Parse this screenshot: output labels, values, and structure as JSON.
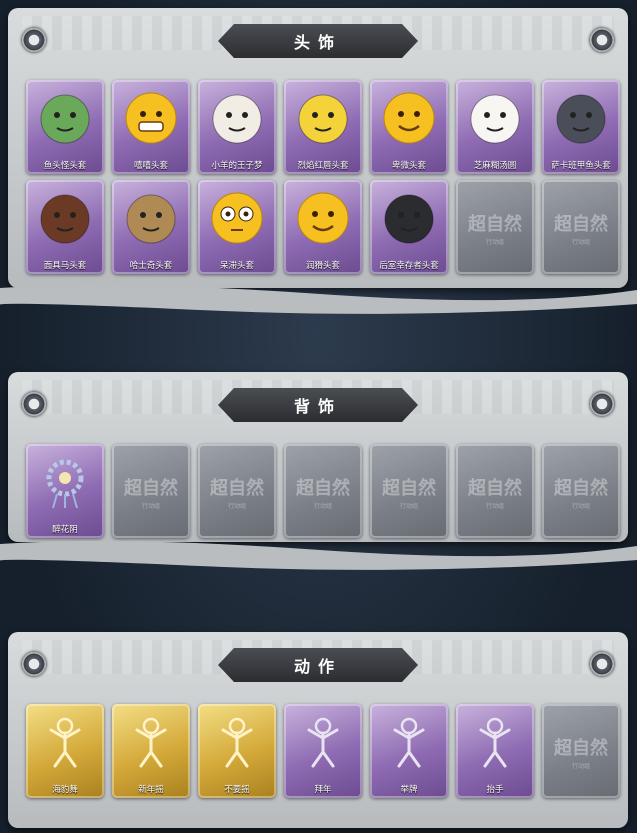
{
  "sections": [
    {
      "title": "头饰",
      "items": [
        {
          "label": "鱼头怪头套",
          "variant": "purple",
          "icon": "fish-mask-icon",
          "color": "#6aa85a"
        },
        {
          "label": "嘻嘻头套",
          "variant": "purple",
          "icon": "grin-emoji-icon",
          "color": "#f5c020"
        },
        {
          "label": "小羊的王子梦",
          "variant": "purple",
          "icon": "sheep-crown-icon",
          "color": "#f1ece4"
        },
        {
          "label": "烈焰红唇头套",
          "variant": "purple",
          "icon": "yellow-mouse-icon",
          "color": "#f3d23a"
        },
        {
          "label": "卑微头套",
          "variant": "purple",
          "icon": "timid-emoji-icon",
          "color": "#f5c020"
        },
        {
          "label": "芝麻糊汤圆",
          "variant": "purple",
          "icon": "dumpling-icon",
          "color": "#f8f6f2"
        },
        {
          "label": "萨卡班甲鱼头套",
          "variant": "purple",
          "icon": "fish-head-icon",
          "color": "#4a4e58"
        },
        {
          "label": "面具马头套",
          "variant": "purple",
          "icon": "horse-mask-icon",
          "color": "#6b3a24"
        },
        {
          "label": "哈士奇头套",
          "variant": "purple",
          "icon": "husky-icon",
          "color": "#b08a55"
        },
        {
          "label": "呆滞头套",
          "variant": "purple",
          "icon": "stunned-emoji-icon",
          "color": "#f5c020"
        },
        {
          "label": "润猾头套",
          "variant": "purple",
          "icon": "smirk-emoji-icon",
          "color": "#f5c020"
        },
        {
          "label": "后室幸存者头套",
          "variant": "purple",
          "icon": "gas-mask-icon",
          "color": "#2a2c30"
        },
        {
          "label": "",
          "variant": "empty",
          "icon": "locked-placeholder-icon"
        },
        {
          "label": "",
          "variant": "empty",
          "icon": "locked-placeholder-icon"
        }
      ]
    },
    {
      "title": "背饰",
      "items": [
        {
          "label": "醉花阴",
          "variant": "purple",
          "icon": "flower-wreath-icon",
          "color": "#b7c9e8"
        },
        {
          "label": "",
          "variant": "empty",
          "icon": "locked-placeholder-icon"
        },
        {
          "label": "",
          "variant": "empty",
          "icon": "locked-placeholder-icon"
        },
        {
          "label": "",
          "variant": "empty",
          "icon": "locked-placeholder-icon"
        },
        {
          "label": "",
          "variant": "empty",
          "icon": "locked-placeholder-icon"
        },
        {
          "label": "",
          "variant": "empty",
          "icon": "locked-placeholder-icon"
        },
        {
          "label": "",
          "variant": "empty",
          "icon": "locked-placeholder-icon"
        }
      ]
    },
    {
      "title": "动作",
      "items": [
        {
          "label": "海豹舞",
          "variant": "gold",
          "icon": "pose-figure-icon",
          "color": "#fff3c8"
        },
        {
          "label": "新年摇",
          "variant": "gold",
          "icon": "pose-figure-icon",
          "color": "#fff3c8"
        },
        {
          "label": "不要摇",
          "variant": "gold",
          "icon": "pose-figure-icon",
          "color": "#fff3c8"
        },
        {
          "label": "拜年",
          "variant": "purple",
          "icon": "bow-figure-icon",
          "color": "#e9e4f2"
        },
        {
          "label": "举牌",
          "variant": "purple",
          "icon": "sign-figure-icon",
          "color": "#e9e4f2"
        },
        {
          "label": "抬手",
          "variant": "purple",
          "icon": "raise-hand-icon",
          "color": "#e9e4f2"
        },
        {
          "label": "",
          "variant": "empty",
          "icon": "locked-placeholder-icon"
        }
      ]
    }
  ],
  "watermark": {
    "main": "超自然",
    "sub": "行动组"
  },
  "colors": {
    "purple": "#8e6bb2",
    "gold": "#d4a93a",
    "empty": "#7a7f87",
    "banner": "#2b2d31"
  }
}
